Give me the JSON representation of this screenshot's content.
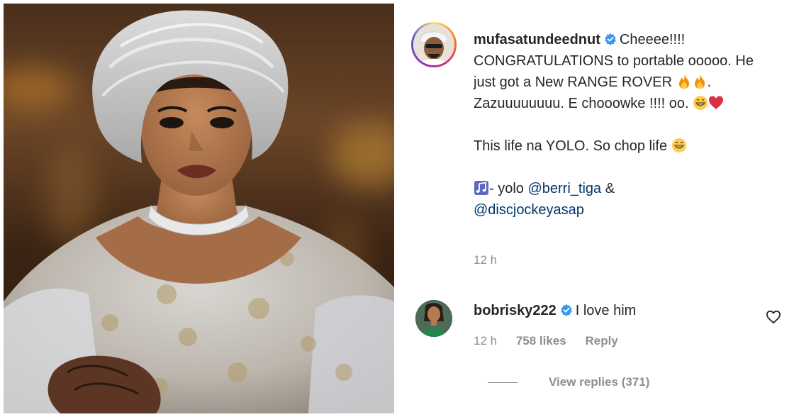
{
  "post": {
    "author": "mufasatundeednut",
    "caption_line1": "Cheeee!!!! CONGRATULATIONS to portable ooooo. He just got a New RANGE ROVER",
    "caption_line2": ". Zazuuuuuuuu. E chooowke !!!! oo.",
    "caption_para2": "This life na YOLO. So chop life",
    "audio_prefix": "- yolo",
    "mention1": "@berri_tiga",
    "amp": "&",
    "mention2": "@discjockeyasap",
    "time": "12 h"
  },
  "reply": {
    "author": "bobrisky222",
    "text": "I love him",
    "time": "12 h",
    "likes": "758 likes",
    "reply_label": "Reply",
    "view_replies": "View replies (371)"
  },
  "icons": {
    "verified": "verified-badge-icon",
    "fire": "fire-emoji-icon",
    "grin": "grinning-emoji-icon",
    "heart_red": "red-heart-emoji-icon",
    "music": "music-note-icon",
    "like": "heart-outline-icon"
  },
  "colors": {
    "verified_blue": "#3897f0",
    "link": "#00376b",
    "muted": "#8e8e8e"
  }
}
